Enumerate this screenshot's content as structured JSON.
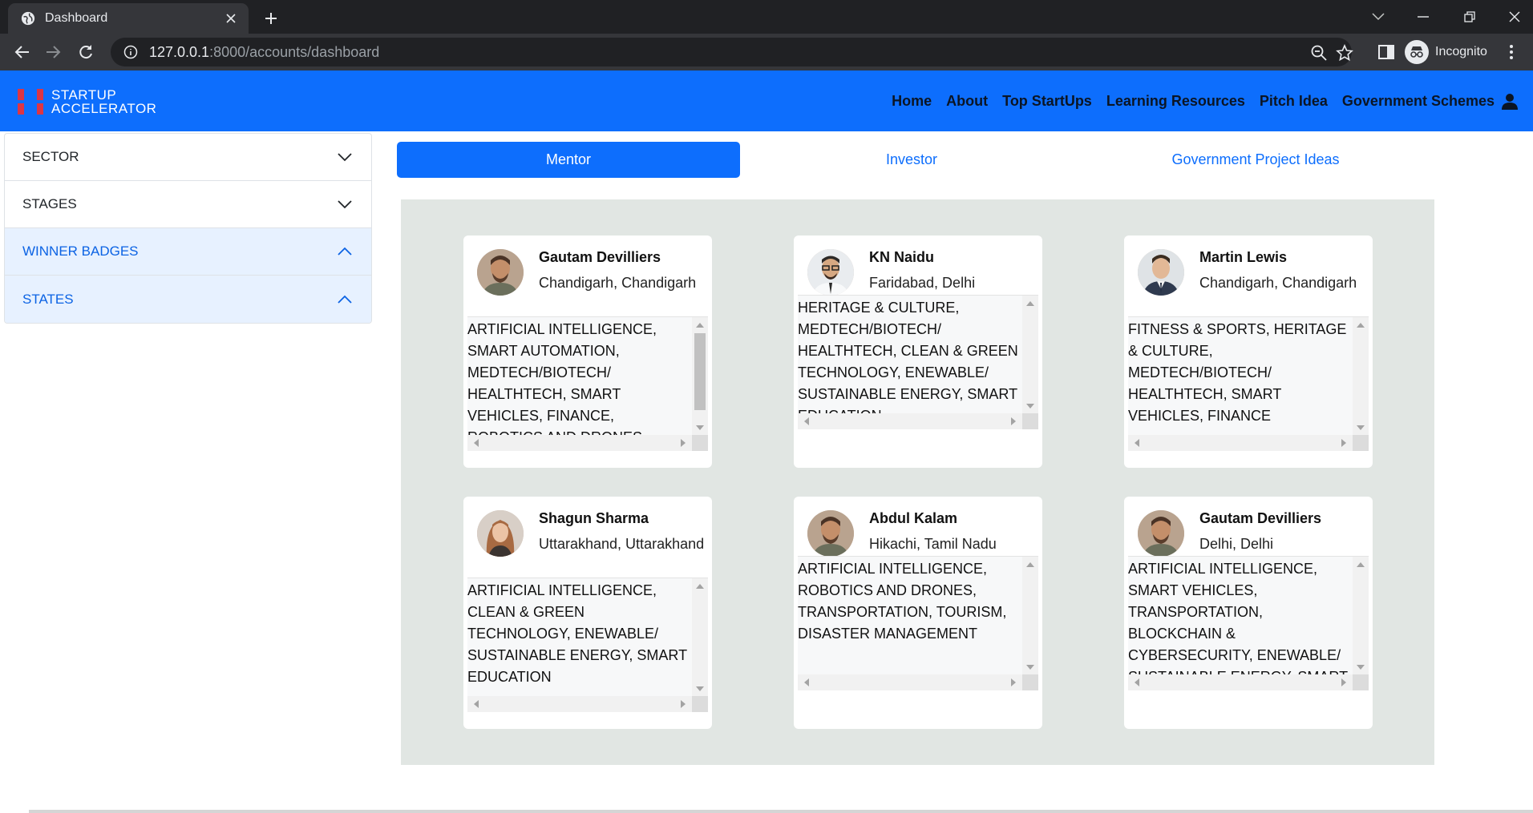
{
  "browser": {
    "tab_title": "Dashboard",
    "url_host": "127.0.0.1",
    "url_rest": ":8000/accounts/dashboard",
    "profile_label": "Incognito"
  },
  "site": {
    "brand_line1": "STARTUP",
    "brand_line2": "ACCELERATOR",
    "nav": [
      "Home",
      "About",
      "Top StartUps",
      "Learning Resources",
      "Pitch Idea",
      "Government Schemes"
    ]
  },
  "sidebar": {
    "items": [
      {
        "label": "SECTOR",
        "state": "collapsed"
      },
      {
        "label": "STAGES",
        "state": "collapsed"
      },
      {
        "label": "WINNER BADGES",
        "state": "expanded"
      },
      {
        "label": "STATES",
        "state": "expanded"
      }
    ]
  },
  "tabs": [
    "Mentor",
    "Investor",
    "Government Project Ideas"
  ],
  "active_tab": "Mentor",
  "mentors": [
    {
      "name": "Gautam Devilliers",
      "location": "Chandigarh, Chandigarh",
      "sectors": "ARTIFICIAL INTELLIGENCE, SMART AUTOMATION, MEDTECH/BIOTECH/ HEALTHTECH, SMART VEHICLES, FINANCE, ROBOTICS AND DRONES, TOURISM"
    },
    {
      "name": "KN Naidu",
      "location": "Faridabad, Delhi",
      "sectors": "HERITAGE & CULTURE, MEDTECH/BIOTECH/ HEALTHTECH, CLEAN & GREEN TECHNOLOGY, ENEWABLE/ SUSTAINABLE ENERGY, SMART EDUCATION"
    },
    {
      "name": "Martin Lewis",
      "location": "Chandigarh, Chandigarh",
      "sectors": "FITNESS & SPORTS, HERITAGE & CULTURE, MEDTECH/BIOTECH/ HEALTHTECH, SMART VEHICLES, FINANCE"
    },
    {
      "name": "Shagun Sharma",
      "location": "Uttarakhand, Uttarakhand",
      "sectors": "ARTIFICIAL INTELLIGENCE, CLEAN & GREEN TECHNOLOGY, ENEWABLE/ SUSTAINABLE ENERGY, SMART EDUCATION"
    },
    {
      "name": "Abdul Kalam",
      "location": "Hikachi, Tamil Nadu",
      "sectors": "ARTIFICIAL INTELLIGENCE, ROBOTICS AND DRONES, TRANSPORTATION, TOURISM, DISASTER MANAGEMENT"
    },
    {
      "name": "Gautam Devilliers",
      "location": "Delhi, Delhi",
      "sectors": "ARTIFICIAL INTELLIGENCE, SMART VEHICLES, TRANSPORTATION, BLOCKCHAIN & CYBERSECURITY, ENEWABLE/ SUSTAINABLE ENERGY, SMART EDUCATION"
    }
  ],
  "colors": {
    "primary": "#0d6efd",
    "brand_red": "#dc3545",
    "card_area": "#e1e6e3"
  }
}
